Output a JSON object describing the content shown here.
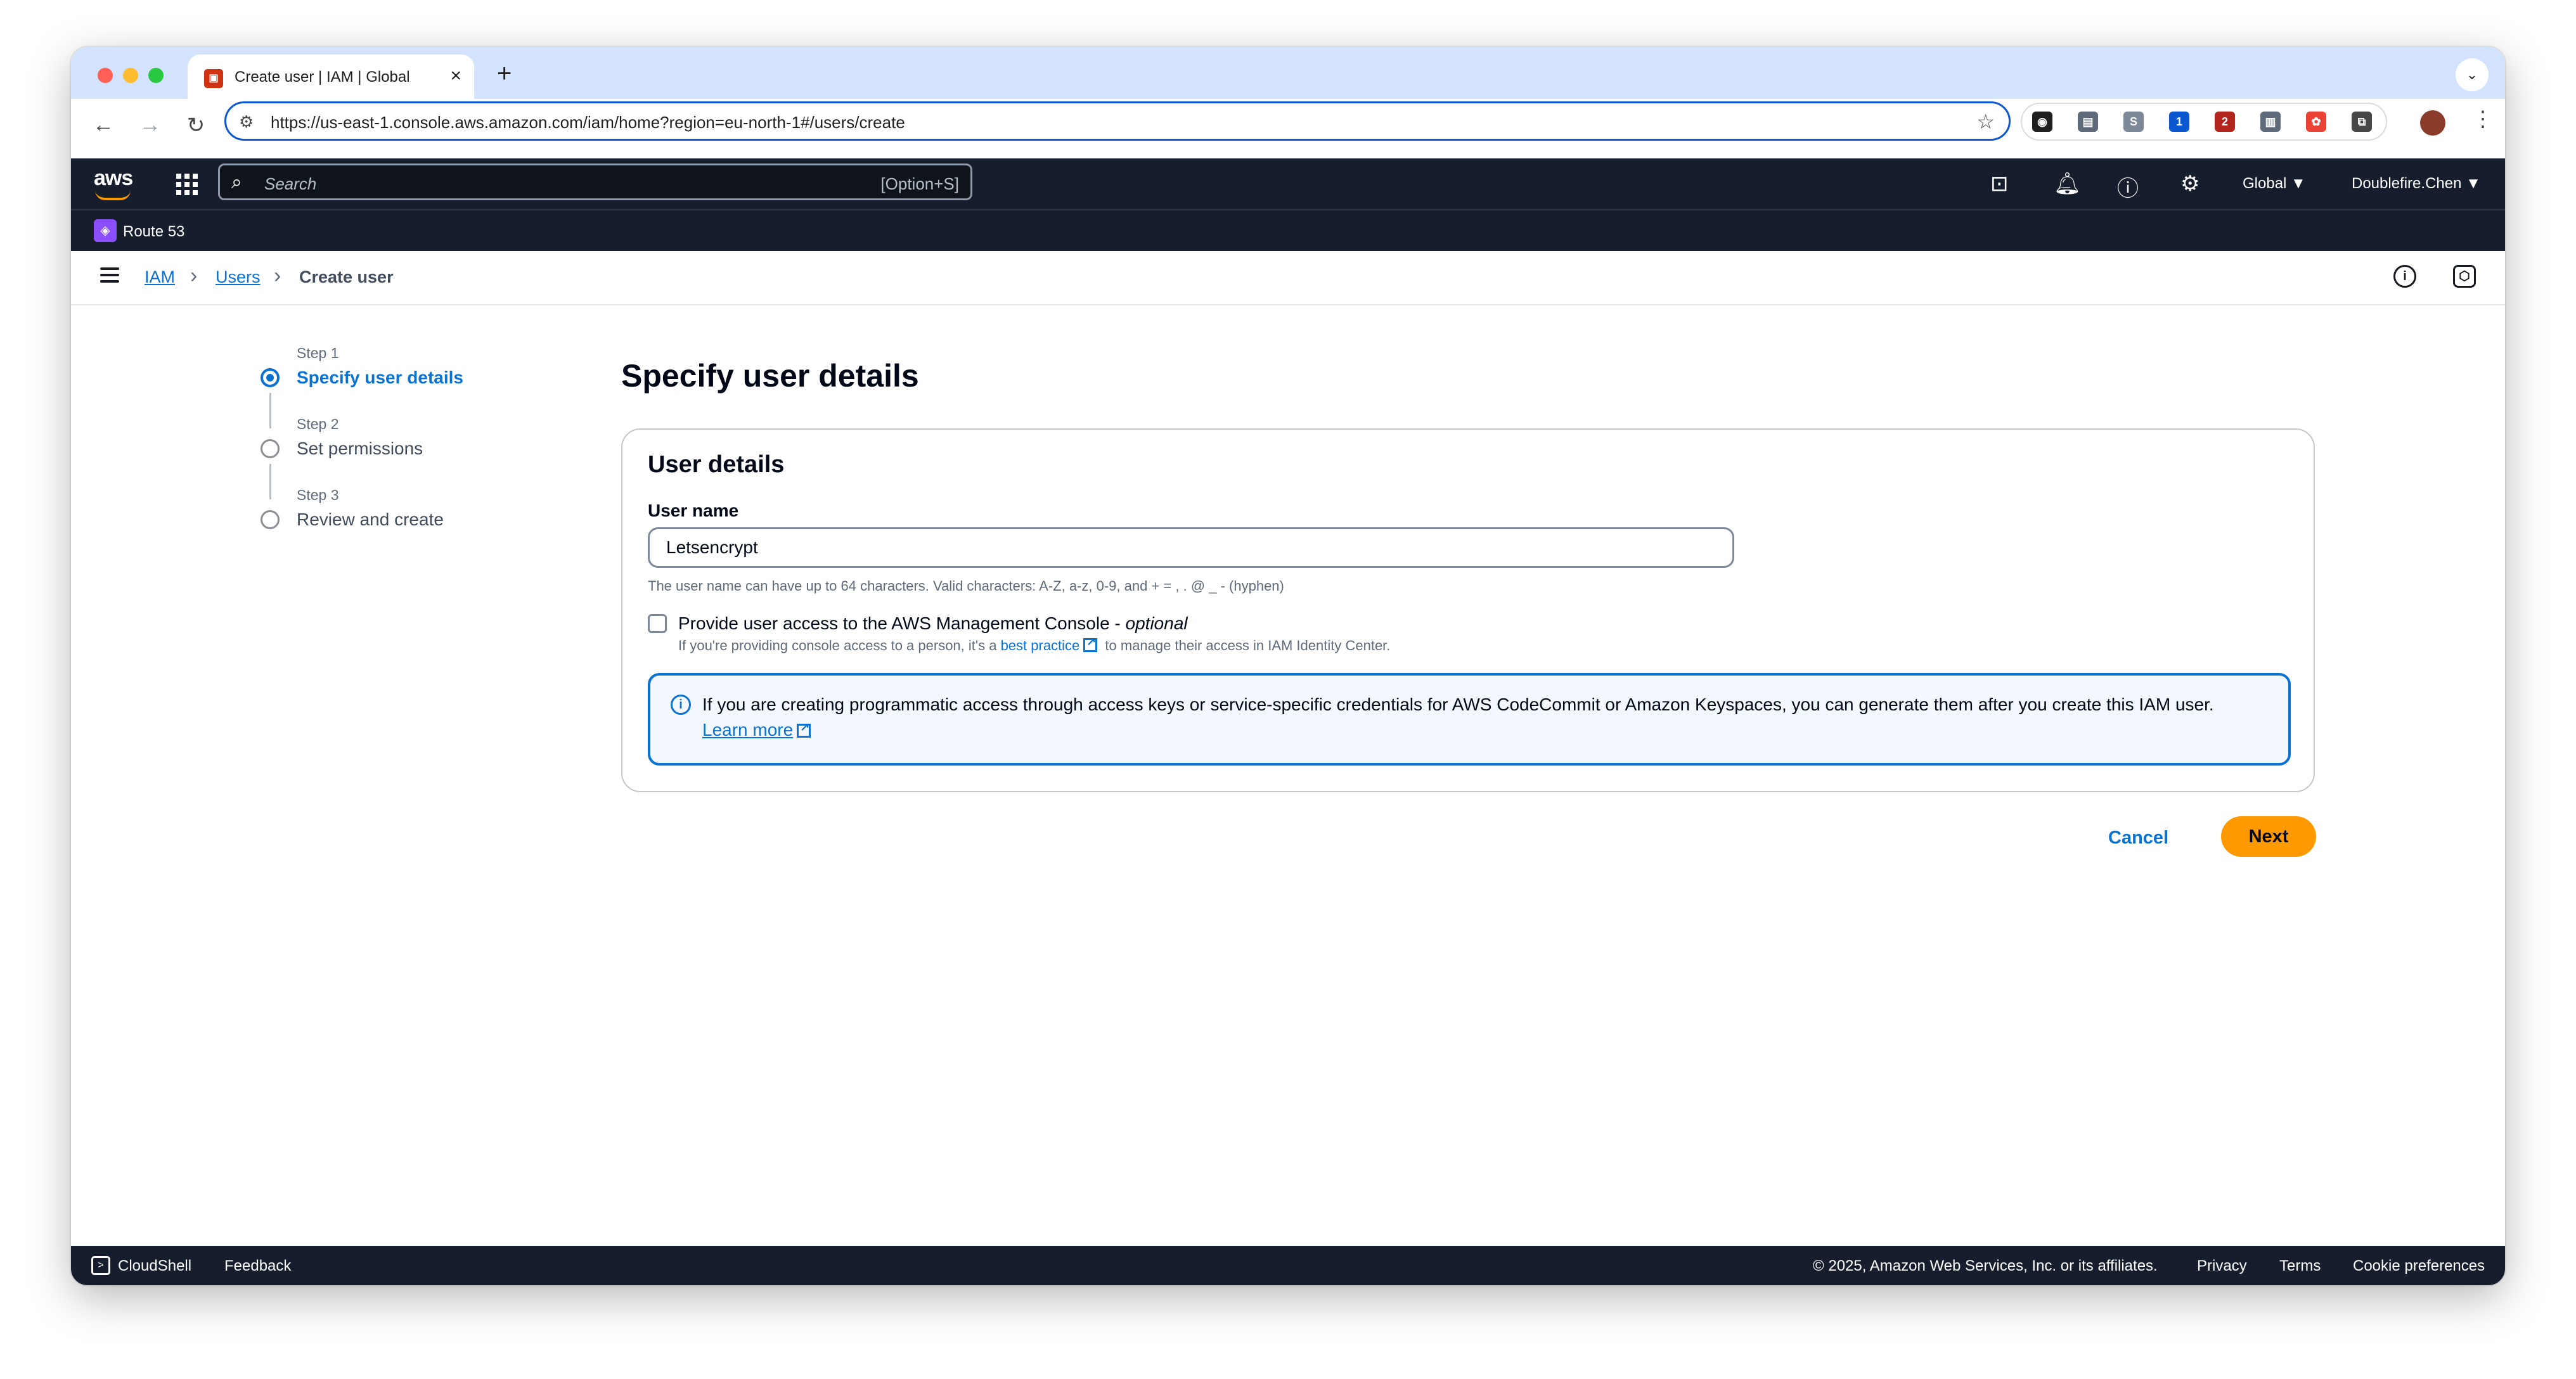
{
  "browser": {
    "tab_title": "Create user | IAM | Global",
    "url": "https://us-east-1.console.aws.amazon.com/iam/home?region=eu-north-1#/users/create",
    "ext_badge_1": "1",
    "ext_badge_2": "2"
  },
  "aws_header": {
    "logo": "aws",
    "search_placeholder": "Search",
    "search_shortcut": "[Option+S]",
    "region": "Global ▼",
    "account": "Doublefire.Chen ▼",
    "favorite_service": "Route 53"
  },
  "breadcrumb": {
    "items": [
      "IAM",
      "Users",
      "Create user"
    ]
  },
  "wizard": {
    "steps": [
      {
        "number": "Step 1",
        "title": "Specify user details",
        "active": true
      },
      {
        "number": "Step 2",
        "title": "Set permissions",
        "active": false
      },
      {
        "number": "Step 3",
        "title": "Review and create",
        "active": false
      }
    ]
  },
  "main": {
    "page_title": "Specify user details",
    "container_title": "User details",
    "username_label": "User name",
    "username_value": "Letsencrypt",
    "username_hint": "The user name can have up to 64 characters. Valid characters: A-Z, a-z, 0-9, and + = , . @ _ - (hyphen)",
    "console_access_label": "Provide user access to the AWS Management Console - ",
    "console_access_optional": "optional",
    "console_access_checked": false,
    "console_desc_prefix": "If you're providing console access to a person, it's a ",
    "console_desc_link": "best practice",
    "console_desc_suffix": " to manage their access in IAM Identity Center.",
    "info_text": "If you are creating programmatic access through access keys or service-specific credentials for AWS CodeCommit or Amazon Keyspaces, you can generate them after you create this IAM user.",
    "info_link": "Learn more",
    "cancel_label": "Cancel",
    "next_label": "Next"
  },
  "footer": {
    "cloudshell": "CloudShell",
    "feedback": "Feedback",
    "copyright": "© 2025, Amazon Web Services, Inc. or its affiliates.",
    "privacy": "Privacy",
    "terms": "Terms",
    "cookie": "Cookie preferences"
  },
  "colors": {
    "accent": "#0972d3",
    "primary_button": "#ff9900",
    "header_bg": "#161e2d"
  }
}
